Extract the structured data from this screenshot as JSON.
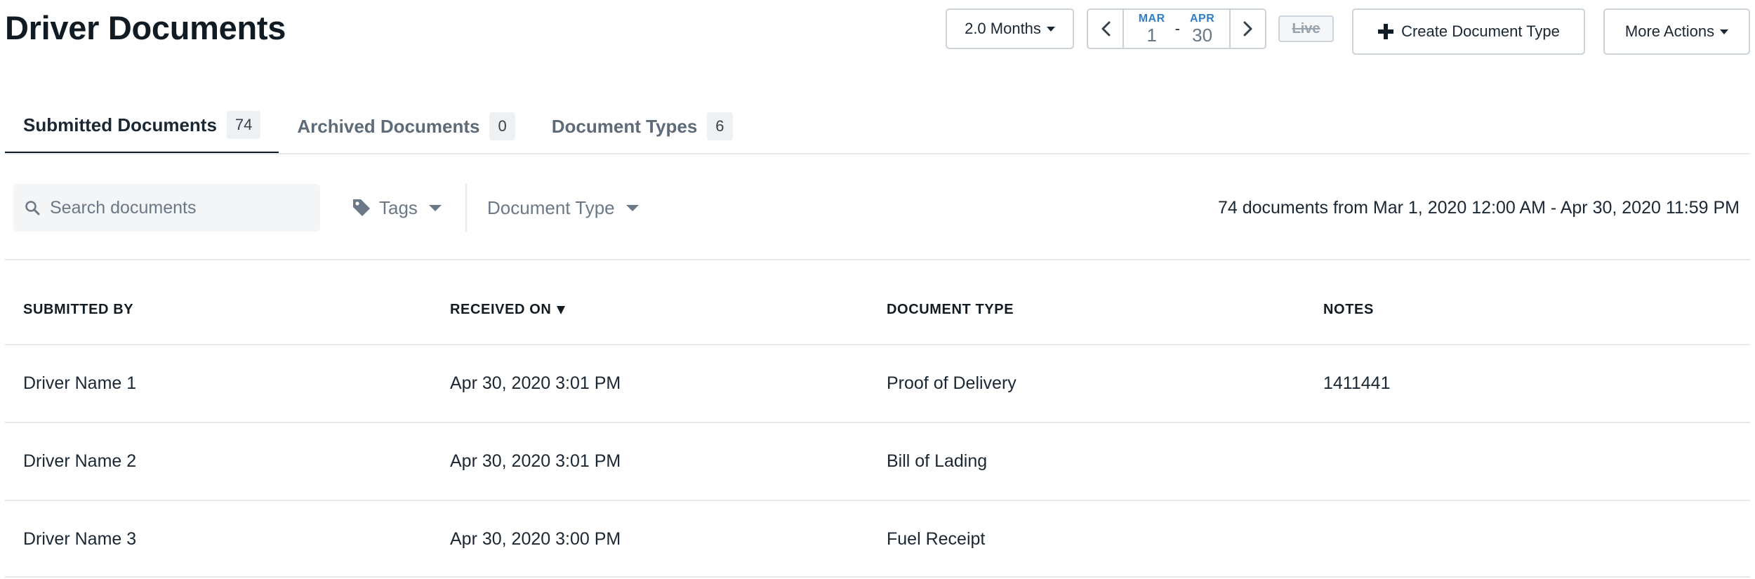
{
  "header": {
    "title": "Driver Documents",
    "range_label": "2.0 Months",
    "date_start": {
      "month": "MAR",
      "day": "1"
    },
    "date_separator": "-",
    "date_end": {
      "month": "APR",
      "day": "30"
    },
    "live_label": "Live",
    "create_label": "Create Document Type",
    "more_label": "More Actions"
  },
  "tabs": [
    {
      "label": "Submitted Documents",
      "count": "74"
    },
    {
      "label": "Archived Documents",
      "count": "0"
    },
    {
      "label": "Document Types",
      "count": "6"
    }
  ],
  "filters": {
    "search_placeholder": "Search documents",
    "tags_label": "Tags",
    "document_type_label": "Document Type",
    "summary": "74 documents from Mar 1, 2020 12:00 AM - Apr 30, 2020 11:59 PM"
  },
  "table": {
    "columns": [
      "SUBMITTED BY",
      "RECEIVED ON",
      "DOCUMENT TYPE",
      "NOTES"
    ],
    "rows": [
      {
        "submitted_by": "Driver Name 1",
        "received_on": "Apr 30, 2020 3:01 PM",
        "document_type": "Proof of Delivery",
        "notes": "1411441"
      },
      {
        "submitted_by": "Driver Name 2",
        "received_on": "Apr 30, 2020 3:01 PM",
        "document_type": "Bill of Lading",
        "notes": ""
      },
      {
        "submitted_by": "Driver Name 3",
        "received_on": "Apr 30, 2020 3:00 PM",
        "document_type": "Fuel Receipt",
        "notes": ""
      }
    ]
  },
  "icons": {
    "prev": "chevron-left-icon",
    "next": "chevron-right-icon",
    "plus": "plus-icon",
    "search": "search-icon",
    "tag": "tag-icon"
  },
  "colors": {
    "accent_blue": "#2f7ec9",
    "text": "#1b2733",
    "muted": "#6b7886",
    "border": "#ccd3da"
  }
}
